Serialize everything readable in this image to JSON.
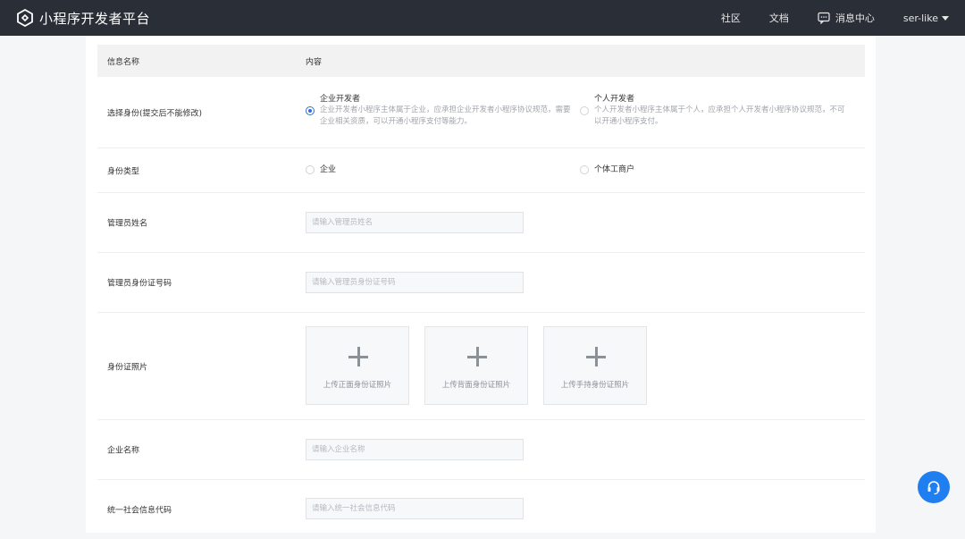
{
  "header": {
    "app_title": "小程序开发者平台",
    "nav": {
      "community": "社区",
      "docs": "文档",
      "messages": "消息中心",
      "user": "ser-like"
    }
  },
  "table": {
    "headers": {
      "field": "信息名称",
      "content": "内容"
    }
  },
  "identity": {
    "label": "选择身份(提交后不能修改)",
    "enterprise": {
      "title": "企业开发者",
      "desc": "企业开发者小程序主体属于企业，应承担企业开发者小程序协议规范，需要企业相关资质，可以开通小程序支付等能力。",
      "selected": true
    },
    "individual": {
      "title": "个人开发者",
      "desc": "个人开发者小程序主体属于个人，应承担个人开发者小程序协议规范，不可以开通小程序支付。",
      "selected": false
    }
  },
  "identity_type": {
    "label": "身份类型",
    "options": [
      "企业",
      "个体工商户"
    ]
  },
  "admin_name": {
    "label": "管理员姓名",
    "placeholder": "请输入管理员姓名"
  },
  "admin_id": {
    "label": "管理员身份证号码",
    "placeholder": "请输入管理员身份证号码"
  },
  "id_photos": {
    "label": "身份证照片",
    "uploads": [
      "上传正面身份证照片",
      "上传背面身份证照片",
      "上传手持身份证照片"
    ]
  },
  "company_name": {
    "label": "企业名称",
    "placeholder": "请输入企业名称"
  },
  "credit_code": {
    "label": "统一社会信息代码",
    "placeholder": "请输入统一社会信息代码"
  },
  "colors": {
    "topbar": "#2a2e36",
    "accent": "#2e6fd9",
    "help_button": "#1f7ef0"
  },
  "icons": {
    "logo": "miniapp-logo-icon",
    "messages": "message-icon",
    "help": "headset-icon"
  }
}
